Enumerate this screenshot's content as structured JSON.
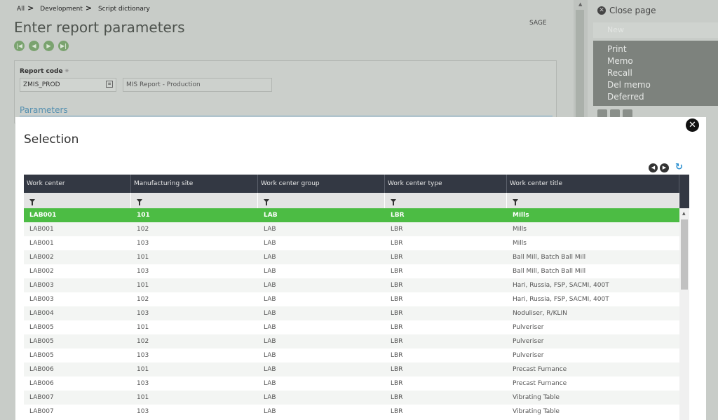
{
  "breadcrumb": [
    "All",
    "Development",
    "Script dictionary"
  ],
  "page": {
    "title": "Enter report parameters",
    "sage_label": "SAGE"
  },
  "report": {
    "code_label": "Report code",
    "code_value": "ZMIS_PROD",
    "description": "MIS Report - Production",
    "parameters_label": "Parameters"
  },
  "sidebar": {
    "close_page": "Close page",
    "new_label": "New",
    "menu": [
      "Print",
      "Memo",
      "Recall",
      "Del memo",
      "Deferred"
    ]
  },
  "modal": {
    "title": "Selection",
    "columns": [
      "Work center",
      "Manufacturing site",
      "Work center group",
      "Work center type",
      "Work center title"
    ],
    "rows": [
      [
        "LAB001",
        "101",
        "LAB",
        "LBR",
        "Mills"
      ],
      [
        "LAB001",
        "102",
        "LAB",
        "LBR",
        "Mills"
      ],
      [
        "LAB001",
        "103",
        "LAB",
        "LBR",
        "Mills"
      ],
      [
        "LAB002",
        "101",
        "LAB",
        "LBR",
        "Ball Mill, Batch Ball Mill"
      ],
      [
        "LAB002",
        "103",
        "LAB",
        "LBR",
        "Ball Mill, Batch Ball Mill"
      ],
      [
        "LAB003",
        "101",
        "LAB",
        "LBR",
        "Hari, Russia, FSP, SACMI, 400T"
      ],
      [
        "LAB003",
        "102",
        "LAB",
        "LBR",
        "Hari, Russia, FSP, SACMI, 400T"
      ],
      [
        "LAB004",
        "103",
        "LAB",
        "LBR",
        "Noduliser, R/KLIN"
      ],
      [
        "LAB005",
        "101",
        "LAB",
        "LBR",
        "Pulveriser"
      ],
      [
        "LAB005",
        "102",
        "LAB",
        "LBR",
        "Pulveriser"
      ],
      [
        "LAB005",
        "103",
        "LAB",
        "LBR",
        "Pulveriser"
      ],
      [
        "LAB006",
        "101",
        "LAB",
        "LBR",
        "Precast Furnance"
      ],
      [
        "LAB006",
        "103",
        "LAB",
        "LBR",
        "Precast Furnance"
      ],
      [
        "LAB007",
        "101",
        "LAB",
        "LBR",
        "Vibrating Table"
      ],
      [
        "LAB007",
        "103",
        "LAB",
        "LBR",
        "Vibrating Table"
      ]
    ],
    "selected_row": 0
  },
  "colors": {
    "selected_row": "#4cbc44",
    "header_bg": "#333843",
    "link_blue": "#5590b0"
  }
}
